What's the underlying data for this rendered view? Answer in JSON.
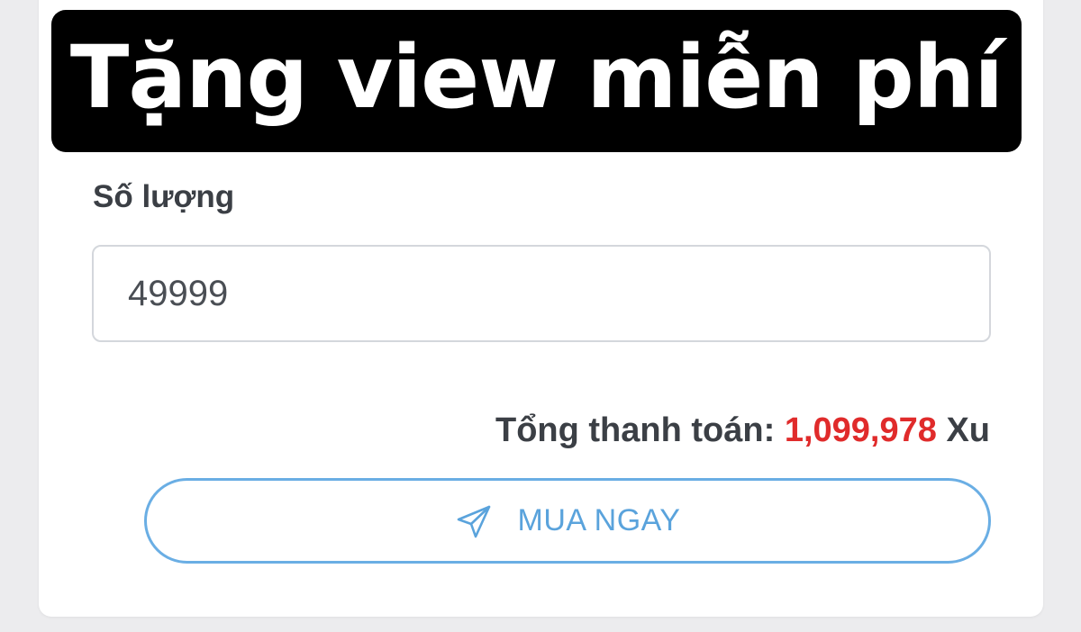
{
  "banner": {
    "title": "Tặng view miễn phí"
  },
  "form": {
    "quantity_label": "Số lượng",
    "quantity_value": "49999",
    "total_label": "Tổng thanh toán:",
    "total_amount": "1,099,978",
    "total_unit": "Xu",
    "buy_button_label": "MUA NGAY",
    "buy_button_icon": "send-icon"
  },
  "colors": {
    "banner_bg": "#000000",
    "amount": "#e02b2b",
    "button_accent": "#5aa3dc"
  }
}
